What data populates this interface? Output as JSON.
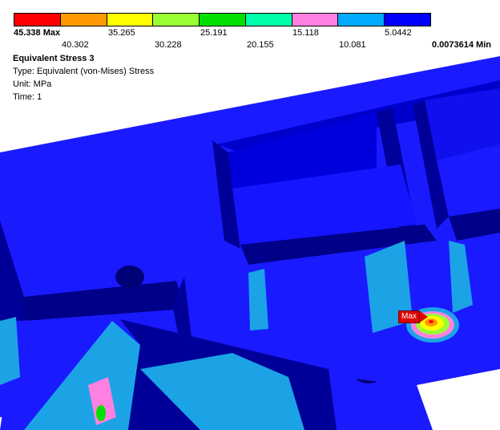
{
  "legend": {
    "colors": [
      "#ff0000",
      "#ff9900",
      "#ffff00",
      "#99ff33",
      "#00e000",
      "#00ffaa",
      "#ff80e0",
      "#00aaff",
      "#0000ff"
    ],
    "top_labels": [
      "45.338 Max",
      "35.265",
      "25.191",
      "15.118",
      "5.0442"
    ],
    "bottom_labels": [
      "40.302",
      "30.228",
      "20.155",
      "10.081",
      "0.0073614 Min"
    ]
  },
  "result": {
    "title": "Equivalent Stress 3",
    "type": "Type: Equivalent (von-Mises) Stress",
    "unit": "Unit: MPa",
    "time": "Time: 1"
  },
  "probe": {
    "label": "Max"
  },
  "colors": {
    "model_blue": "#1a1aff",
    "model_dark": "#000088",
    "model_mid": "#0000cc",
    "light_blue": "#1ba3e6",
    "background": "#ffffff"
  }
}
